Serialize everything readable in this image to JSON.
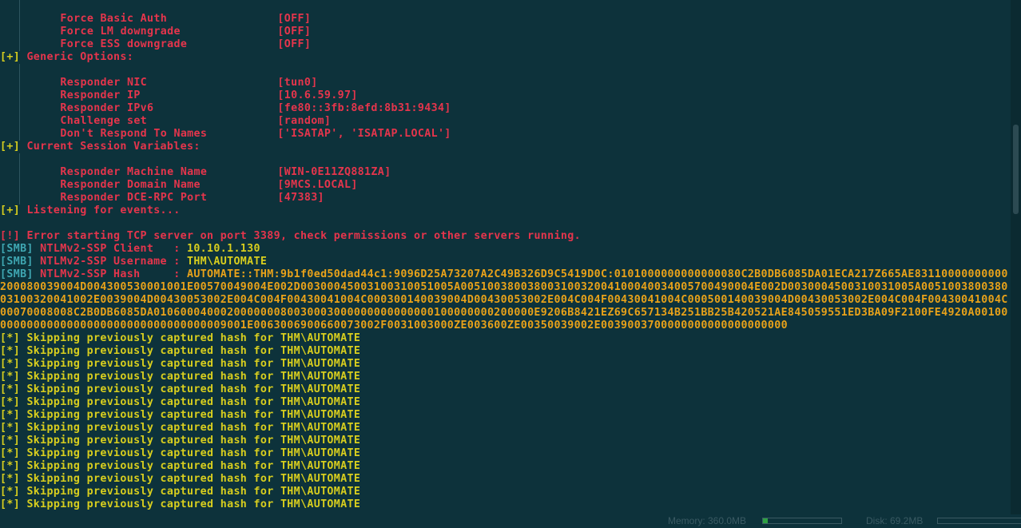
{
  "settings_top": [
    {
      "key": "Force Basic Auth",
      "value": "[OFF]"
    },
    {
      "key": "Force LM downgrade",
      "value": "[OFF]"
    },
    {
      "key": "Force ESS downgrade",
      "value": "[OFF]"
    }
  ],
  "generic": {
    "prefix": "[+]",
    "heading": "Generic Options:",
    "items": [
      {
        "key": "Responder NIC",
        "value": "[tun0]"
      },
      {
        "key": "Responder IP",
        "value": "[10.6.59.97]"
      },
      {
        "key": "Responder IPv6",
        "value": "[fe80::3fb:8efd:8b31:9434]"
      },
      {
        "key": "Challenge set",
        "value": "[random]"
      },
      {
        "key": "Don't Respond To Names",
        "value": "['ISATAP', 'ISATAP.LOCAL']"
      }
    ]
  },
  "session": {
    "prefix": "[+]",
    "heading": "Current Session Variables:",
    "items": [
      {
        "key": "Responder Machine Name",
        "value": "[WIN-0E11ZQ881ZA]"
      },
      {
        "key": "Responder Domain Name",
        "value": "[9MCS.LOCAL]"
      },
      {
        "key": "Responder DCE-RPC Port",
        "value": "[47383]"
      }
    ]
  },
  "listening": {
    "prefix": "[+]",
    "text": "Listening for events..."
  },
  "error": {
    "prefix": "[!]",
    "text": "Error starting TCP server on port 3389, check permissions or other servers running."
  },
  "smb": {
    "tag": "[SMB]",
    "client_label": "NTLMv2-SSP Client   : ",
    "client_value": "10.10.1.130",
    "username_label": "NTLMv2-SSP Username : ",
    "username_value": "THM\\AUTOMATE",
    "hash_label": "NTLMv2-SSP Hash     : ",
    "hash_value": "AUTOMATE::THM:9b1f0ed50dad44c1:9096D25A73207A2C49B326D9C5419D0C:0101000000000000080C2B0DB6085DA01ECA217Z665AE83110000000000200080039004D004300530001001E00570049004E002D00300045003100310051005A00510038003800310032004100040034005700490004E002D0030004500310031005A005100380038003100320041002E0039004D00430053002E004C004F00430041004C000300140039004D00430053002E004C004F00430041004C000500140039004D00430053002E004C004F00430041004C00070008008C2B0DB6085DA010600040002000000080030003000000000000000100000000200000E9206B8421EZ69C657134B251BB25B420521AE845059551ED3BA09F2100FE4920A001000000000000000000000000000000000009001E0063006900660073002F0031003000ZE003600ZE00350039002E0039003700000000000000000000"
  },
  "skip": {
    "prefix": "[*]",
    "text": "Skipping previously captured hash for THM\\AUTOMATE",
    "count": 14
  },
  "status": {
    "memory_label": "Memory: 360.0MB",
    "memory_fraction": 0.06,
    "disk_label": "Disk: 69.2MB",
    "disk_fraction": 0.0
  },
  "colors": {
    "background": "#0d323b",
    "red": "#e5354c",
    "orange": "#e8a21a",
    "yellow": "#d8ce1e",
    "teal": "#3fa7b2"
  }
}
